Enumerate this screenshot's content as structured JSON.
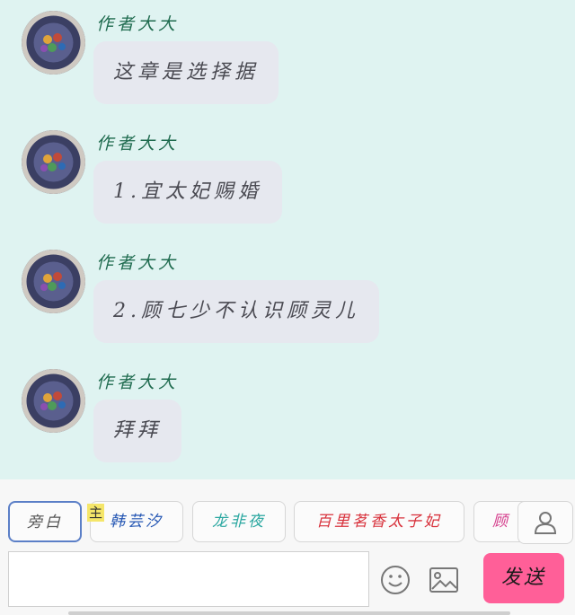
{
  "messages": [
    {
      "sender": "作者大大",
      "text": "这章是选择据"
    },
    {
      "sender": "作者大大",
      "text": "1.宜太妃赐婚"
    },
    {
      "sender": "作者大大",
      "text": "2.顾七少不认识顾灵儿"
    },
    {
      "sender": "作者大大",
      "text": "拜拜"
    }
  ],
  "roles": [
    {
      "label": "旁白",
      "color": "#555555"
    },
    {
      "label": "韩芸汐",
      "color": "#2456b3"
    },
    {
      "label": "龙非夜",
      "color": "#2aa7a0"
    },
    {
      "label": "百里茗香太子妃",
      "color": "#d8323c"
    },
    {
      "label": "顾",
      "color": "#d43a8a"
    }
  ],
  "main_badge": "主",
  "icons": {
    "contact": "person-icon",
    "emoji": "smiley-icon",
    "image": "image-icon"
  },
  "send_label": "发送",
  "colors": {
    "background": "#dff3f1",
    "bubble": "#e6e8ef",
    "sender": "#1f6b4f",
    "send_button": "#ff5f98"
  }
}
